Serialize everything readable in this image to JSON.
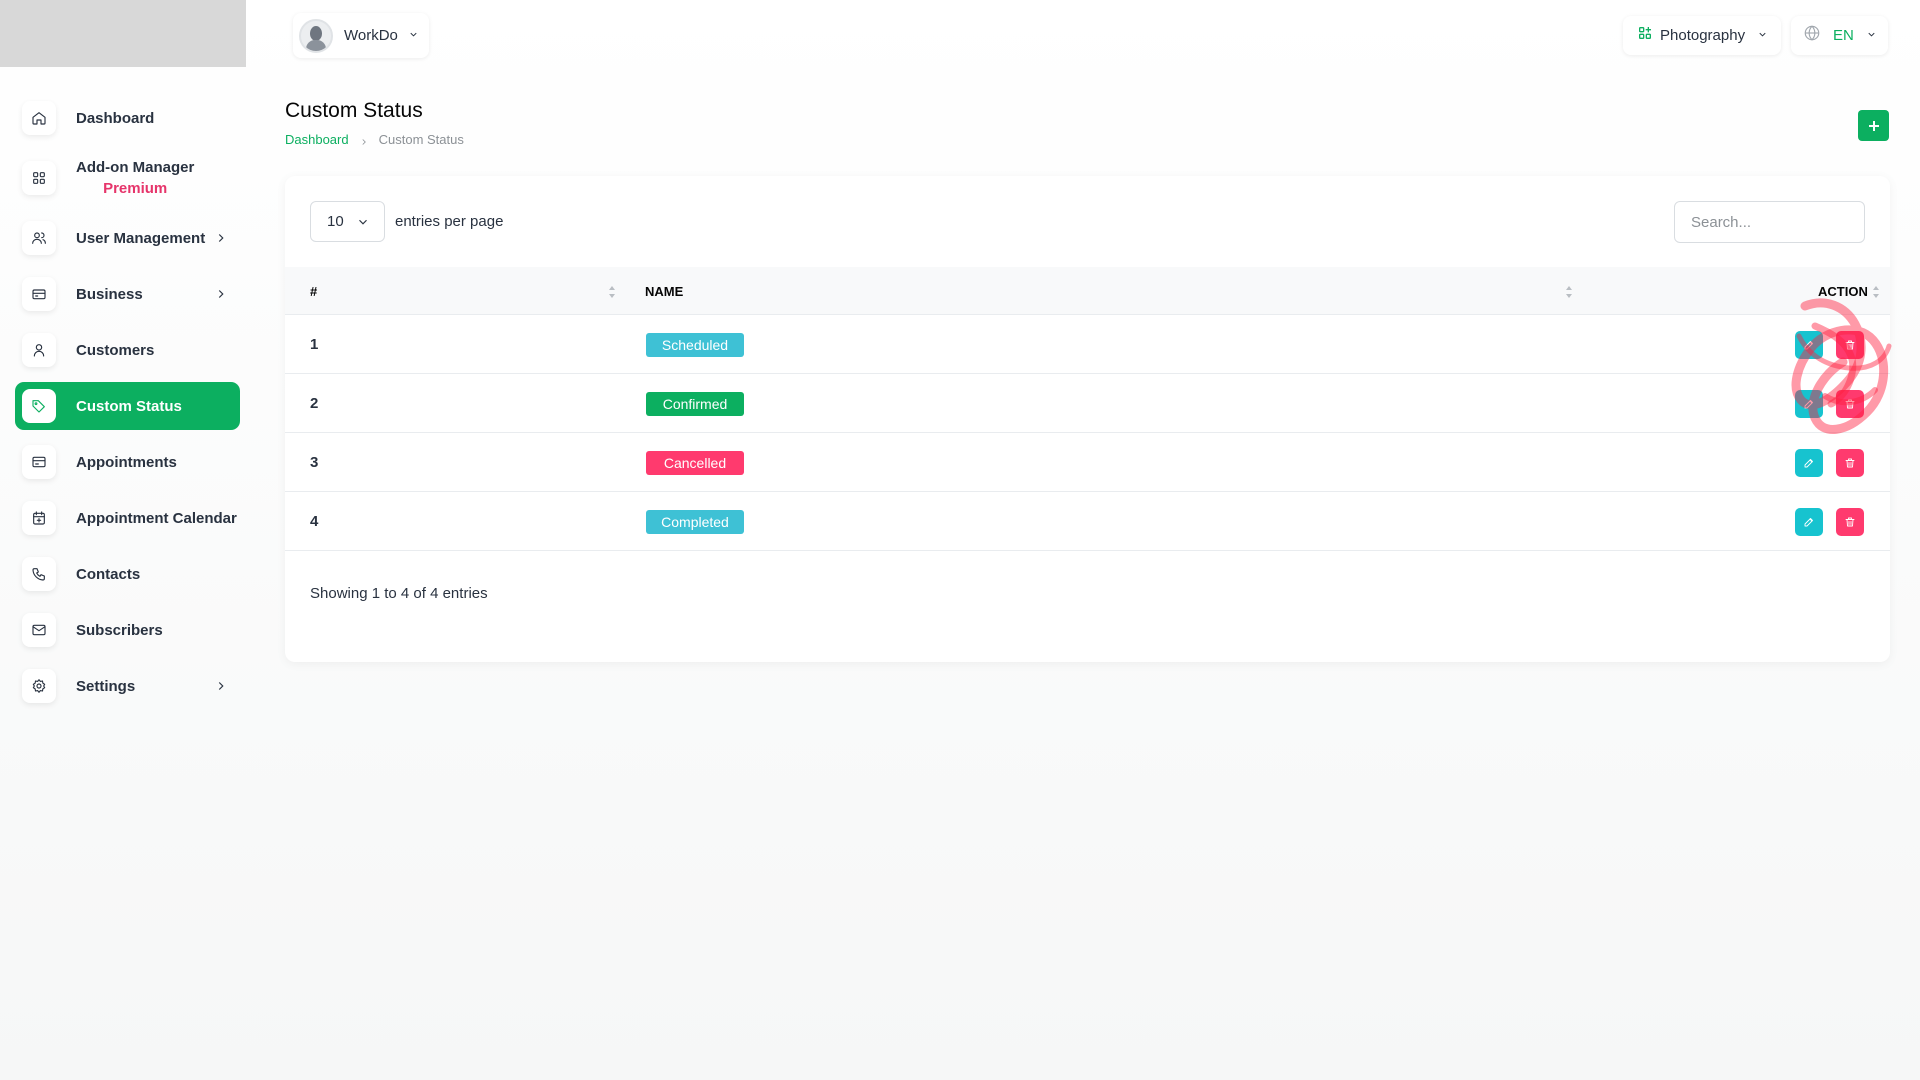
{
  "sidebar": {
    "items": [
      {
        "label": "Dashboard",
        "icon": "home-icon"
      },
      {
        "label": "Add-on Manager",
        "badge": "Premium",
        "icon": "apps-icon"
      },
      {
        "label": "User Management",
        "icon": "users-icon",
        "has_children": true
      },
      {
        "label": "Business",
        "icon": "briefcase-icon",
        "has_children": true
      },
      {
        "label": "Customers",
        "icon": "user-icon"
      },
      {
        "label": "Custom Status",
        "icon": "tag-icon",
        "active": true
      },
      {
        "label": "Appointments",
        "icon": "card-icon"
      },
      {
        "label": "Appointment Calendar",
        "icon": "calendar-icon"
      },
      {
        "label": "Contacts",
        "icon": "phone-icon"
      },
      {
        "label": "Subscribers",
        "icon": "mail-icon"
      },
      {
        "label": "Settings",
        "icon": "gear-icon",
        "has_children": true
      }
    ]
  },
  "header": {
    "workspace_name": "WorkDo",
    "business_name": "Photography",
    "language": "EN"
  },
  "page": {
    "title": "Custom Status",
    "breadcrumb": {
      "home": "Dashboard",
      "current": "Custom Status"
    }
  },
  "table_controls": {
    "per_page_value": "10",
    "per_page_label": "entries per page",
    "search_placeholder": "Search..."
  },
  "table": {
    "columns": [
      "#",
      "NAME",
      "ACTION"
    ],
    "rows": [
      {
        "num": "1",
        "name": "Scheduled",
        "color": "#3ec1d5"
      },
      {
        "num": "2",
        "name": "Confirmed",
        "color": "#0caf60"
      },
      {
        "num": "3",
        "name": "Cancelled",
        "color": "#ff3a6e"
      },
      {
        "num": "4",
        "name": "Completed",
        "color": "#3ec1d5"
      }
    ],
    "footer": "Showing 1 to 4 of 4 entries"
  },
  "colors": {
    "accent": "#0caf60",
    "edit_button": "#17c3cf",
    "delete_button": "#ff3a6e",
    "premium": "#e6356b"
  }
}
